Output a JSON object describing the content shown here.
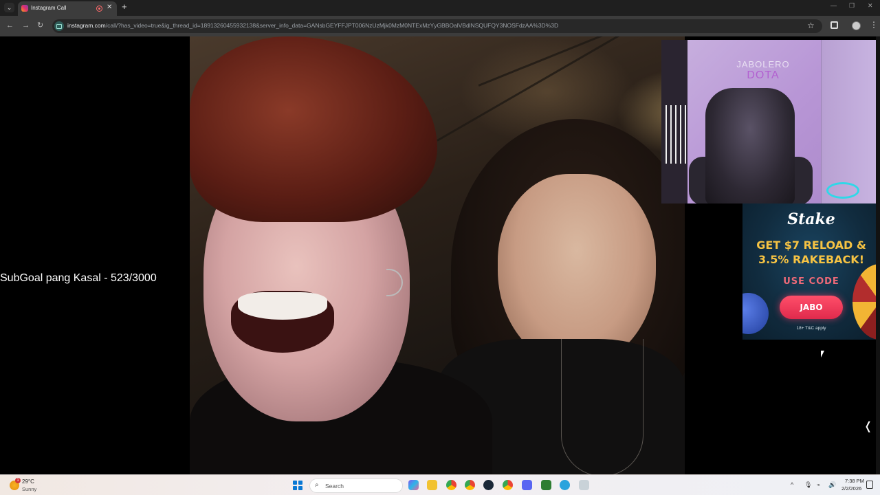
{
  "browser": {
    "tab": {
      "title": "Instagram Call"
    },
    "address": {
      "host": "instagram.com",
      "path": "/call/?has_video=true&ig_thread_id=18913260455932138&server_info_data=GANsbGEYFFJPT006NzUzMjk0MzM0NTExMzYyGBBOalVBdlNSQUFQY3NOSFdzAA%3D%3D"
    }
  },
  "overlay": {
    "subgoal_text": "SubGoal pang Kasal - 523/3000",
    "camera_sign_line1": "JABOLERO",
    "camera_sign_line2": "DOTA"
  },
  "promo": {
    "logo": "Stake",
    "headline_line1": "GET $7 RELOAD &",
    "headline_line2": "3.5% RAKEBACK!",
    "use_code": "USE CODE",
    "code": "JABO",
    "terms": "18+ T&C apply"
  },
  "taskbar": {
    "weather": {
      "temp": "29°C",
      "condition": "Sunny",
      "badge": "1"
    },
    "search_placeholder": "Search",
    "clock": {
      "time": "7:38 PM",
      "date": "2/2/2026"
    }
  },
  "colors": {
    "accent_promo_button": "#e02a4c",
    "promo_headline": "#f6c343",
    "windows_blue": "#0a78d4"
  }
}
